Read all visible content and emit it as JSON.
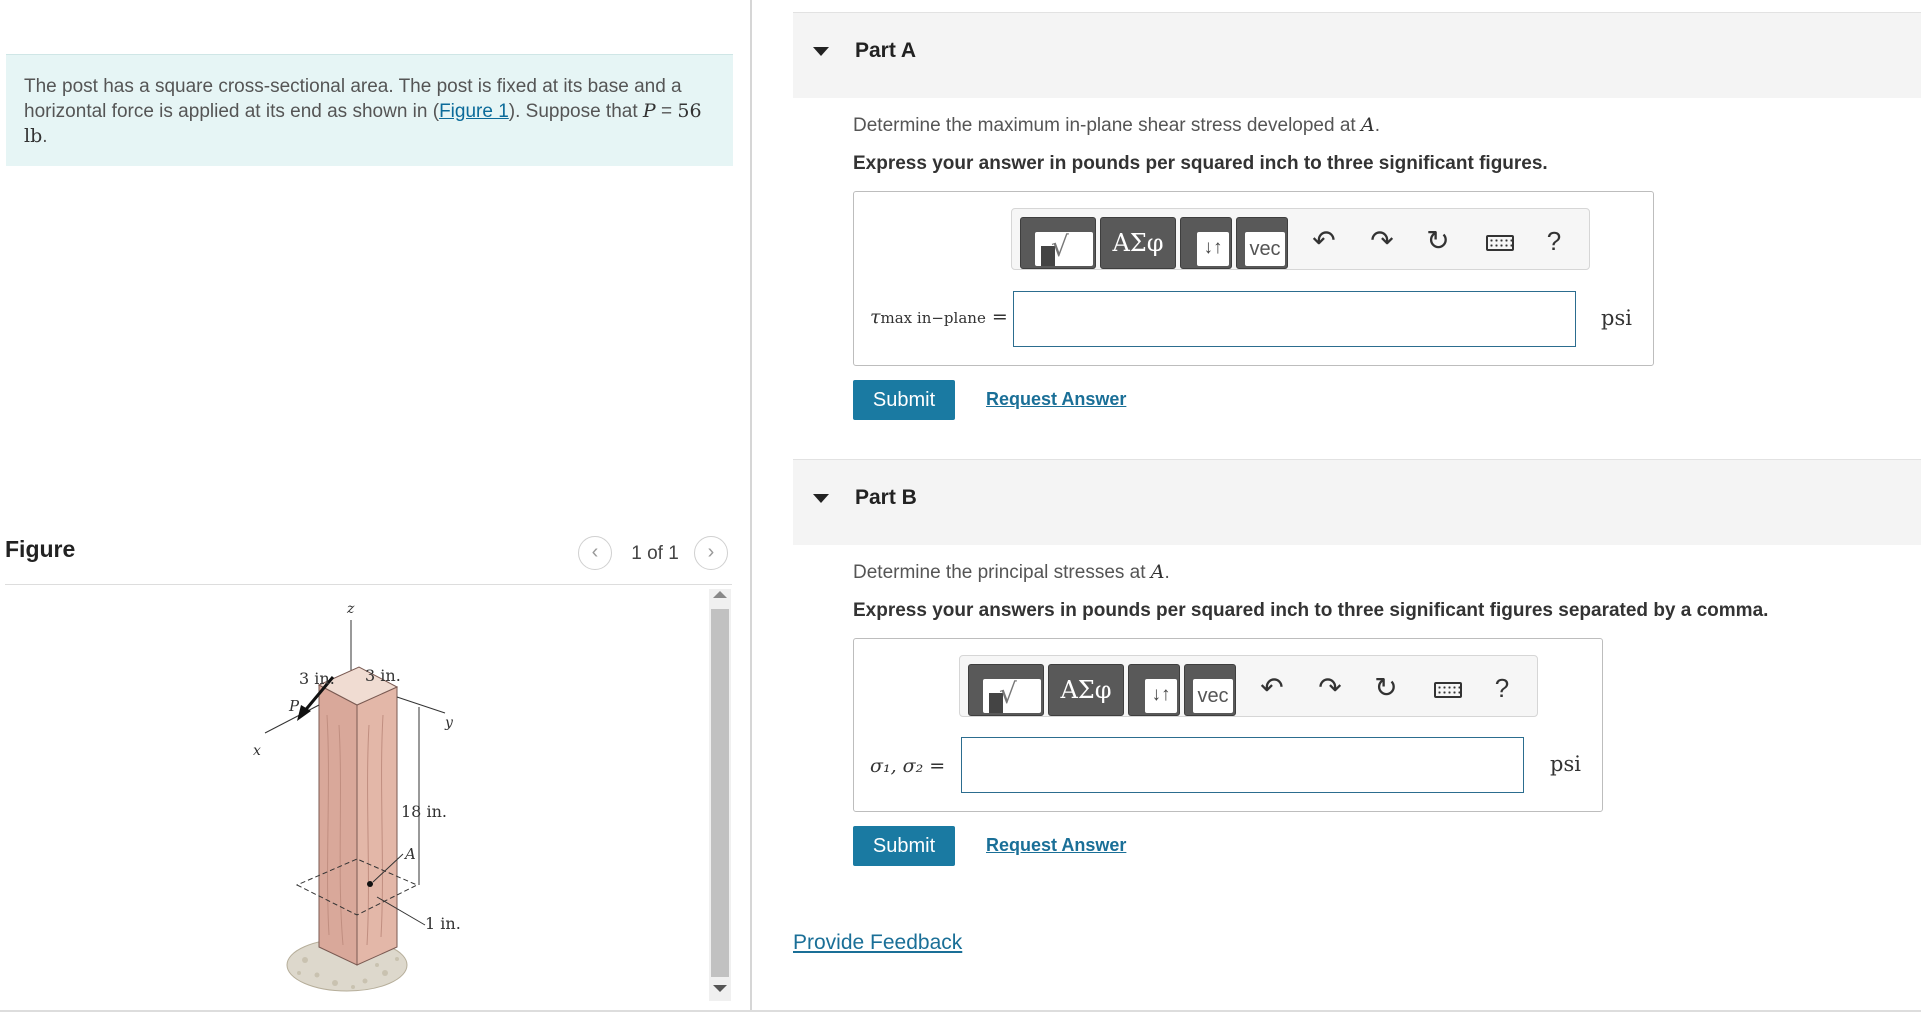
{
  "problem": {
    "text_before": "The post has a square cross-sectional area. The post is fixed at its base and a horizontal force is applied at its end as shown in (",
    "figure_link": "Figure 1",
    "text_middle": "). Suppose that ",
    "var_p": "P",
    "equals": " = ",
    "p_value": "56 lb",
    "text_end": "."
  },
  "figure_panel": {
    "title": "Figure",
    "pager_text": "1 of 1",
    "prev_icon": "chevron-left-icon",
    "next_icon": "chevron-right-icon",
    "labels": {
      "z": "z",
      "x": "x",
      "y": "y",
      "p": "P",
      "a": "A",
      "dim_left": "3 in.",
      "dim_right": "3 in.",
      "height": "18 in.",
      "offset": "1 in."
    }
  },
  "toolbar": {
    "templates_icon": "templates-icon",
    "greek_label": "ΑΣφ",
    "updown_label": "↓↑",
    "vec_label": "vec",
    "undo_icon": "undo-icon",
    "redo_icon": "redo-icon",
    "reset_icon": "reset-icon",
    "keyboard_icon": "keyboard-icon",
    "help_label": "?"
  },
  "part_a": {
    "title": "Part A",
    "question_prefix": "Determine the maximum in-plane shear stress developed at ",
    "question_var": "A",
    "question_suffix": ".",
    "instruction": "Express your answer in pounds per squared inch to three significant figures.",
    "label_main": "τ",
    "label_sub": "max in−plane",
    "label_eq": " =",
    "input_value": "",
    "unit": "psi",
    "submit_label": "Submit",
    "request_label": "Request Answer"
  },
  "part_b": {
    "title": "Part B",
    "question_prefix": "Determine the principal stresses at ",
    "question_var": "A",
    "question_suffix": ".",
    "instruction": "Express your answers in pounds per squared inch to three significant figures separated by a comma.",
    "label": "σ₁, σ₂ =",
    "input_value": "",
    "unit": "psi",
    "submit_label": "Submit",
    "request_label": "Request Answer"
  },
  "feedback_label": "Provide Feedback",
  "colors": {
    "accent": "#1a7aa2",
    "problem_bg": "#e6f5f5",
    "part_header_bg": "#f4f4f4"
  }
}
